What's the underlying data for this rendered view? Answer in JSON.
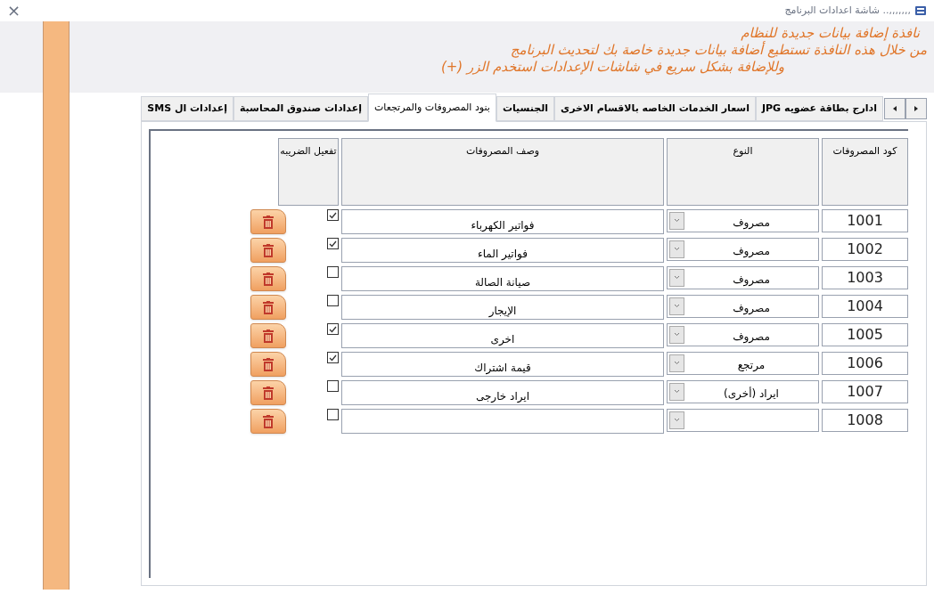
{
  "window": {
    "title": ",,,,,,,.. شاشة اعدادات البرنامج",
    "close": "×"
  },
  "header": {
    "lines": [
      "نافذة إضافة بيانات جديدة للنظام",
      "من خلال هذه النافذة تستطيع أضافة بيانات جديدة خاصة بك لتحديث البرنامج",
      "وللإضافة بشكل سريع في شاشات الإعدادات استخدم الزر (+)"
    ]
  },
  "tabs": [
    {
      "label": "ادارج بطاقة عضويه JPG",
      "selected": false
    },
    {
      "label": "اسعار الخدمات الخاصه بالاقسام الاخرى",
      "selected": false
    },
    {
      "label": "الجنسيات",
      "selected": false
    },
    {
      "label": "بنود المصروفات والمرتجعات",
      "selected": true
    },
    {
      "label": "إعدادات صندوق المحاسبة",
      "selected": false
    },
    {
      "label": "إعدادات ال SMS",
      "selected": false
    }
  ],
  "table": {
    "columns": [
      "كود المصروفات",
      "النوع",
      "وصف المصروفات",
      "تفعيل الضريبه"
    ],
    "rows": [
      {
        "code": "1001",
        "type": "مصروف",
        "description": "فواتير الكهرباء",
        "tax_enabled": true
      },
      {
        "code": "1002",
        "type": "مصروف",
        "description": "فواتير الماء",
        "tax_enabled": true
      },
      {
        "code": "1003",
        "type": "مصروف",
        "description": "صيانة الصالة",
        "tax_enabled": false
      },
      {
        "code": "1004",
        "type": "مصروف",
        "description": "الإيجار",
        "tax_enabled": false
      },
      {
        "code": "1005",
        "type": "مصروف",
        "description": "اخرى",
        "tax_enabled": true
      },
      {
        "code": "1006",
        "type": "مرتجع",
        "description": "قيمة اشتراك",
        "tax_enabled": true
      },
      {
        "code": "1007",
        "type": "ايراد (أخرى)",
        "description": "ايراد خارجى",
        "tax_enabled": false
      },
      {
        "code": "1008",
        "tax_enabled": false
      }
    ]
  }
}
